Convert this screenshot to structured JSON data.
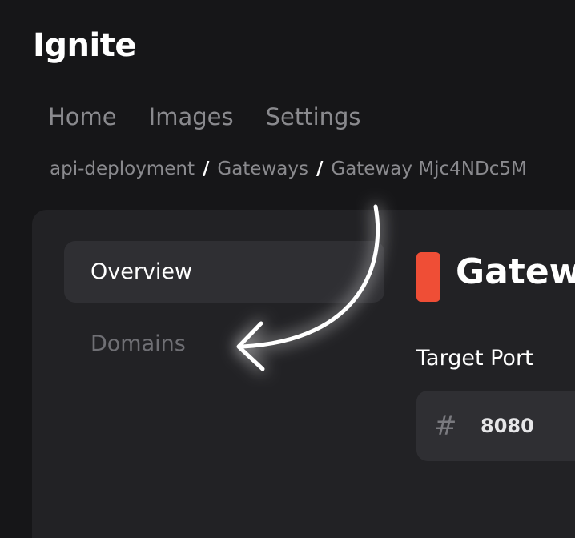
{
  "app": {
    "title": "Ignite"
  },
  "nav": {
    "items": [
      {
        "label": "Home"
      },
      {
        "label": "Images"
      },
      {
        "label": "Settings"
      }
    ]
  },
  "breadcrumb": {
    "separator": "/",
    "items": [
      {
        "label": "api-deployment"
      },
      {
        "label": "Gateways"
      },
      {
        "label": "Gateway Mjc4NDc5M"
      }
    ]
  },
  "sidebar": {
    "items": [
      {
        "label": "Overview",
        "active": true
      },
      {
        "label": "Domains",
        "active": false
      }
    ]
  },
  "detail": {
    "title": "Gatew",
    "chip_color": "#ef4e36",
    "target_port": {
      "label": "Target Port",
      "icon": "hash-icon",
      "value": "8080"
    }
  },
  "annotation": {
    "icon": "curved-arrow-icon",
    "color": "#ffffff"
  }
}
